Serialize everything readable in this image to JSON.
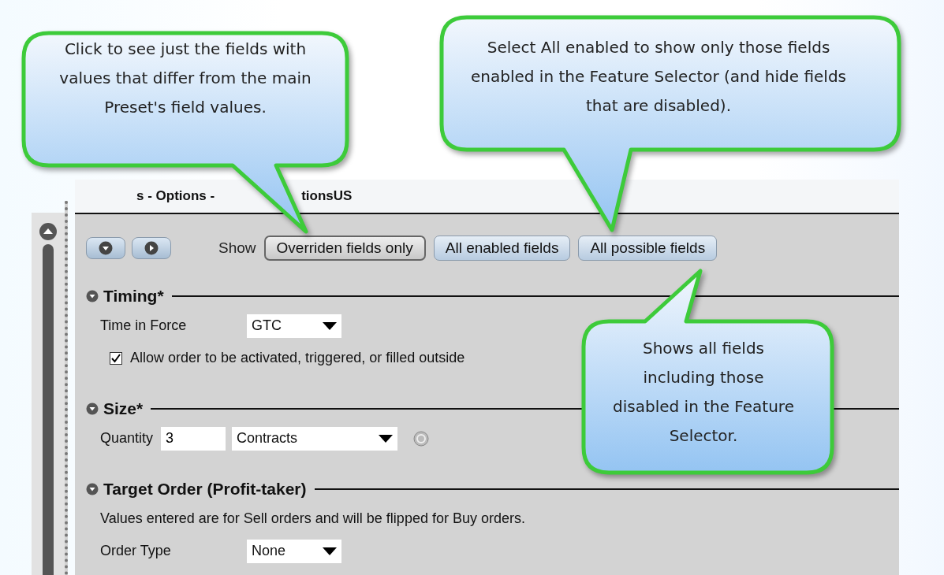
{
  "title_segments": [
    "s - Options -",
    "tionsUS"
  ],
  "toolbar": {
    "show_label": "Show",
    "filters": [
      {
        "label": "Overriden fields only",
        "selected": true
      },
      {
        "label": "All enabled fields",
        "selected": false
      },
      {
        "label": "All possible fields",
        "selected": false
      }
    ]
  },
  "sections": [
    {
      "title": "Timing*",
      "rows": [
        {
          "kind": "dropdown",
          "label": "Time in Force",
          "value": "GTC"
        },
        {
          "kind": "checkbox",
          "label": "Allow order to be activated, triggered, or filled outside",
          "checked": true
        }
      ]
    },
    {
      "title": "Size*",
      "rows": [
        {
          "kind": "quantity",
          "label": "Quantity",
          "value": "3",
          "unit": "Contracts"
        }
      ]
    },
    {
      "title": "Target Order (Profit-taker)",
      "rows": [
        {
          "kind": "note",
          "text": "Values entered are for Sell orders and will be flipped for Buy orders."
        },
        {
          "kind": "dropdown",
          "label": "Order Type",
          "value": "None"
        }
      ]
    }
  ],
  "callouts": [
    {
      "text": "Click to see just the fields with values that differ from the main Preset's field values."
    },
    {
      "text": "Select All enabled to show only those fields enabled in the Feature Selector (and hide fields that are disabled)."
    },
    {
      "text": "Shows all fields including those disabled in the Feature Selector."
    }
  ]
}
